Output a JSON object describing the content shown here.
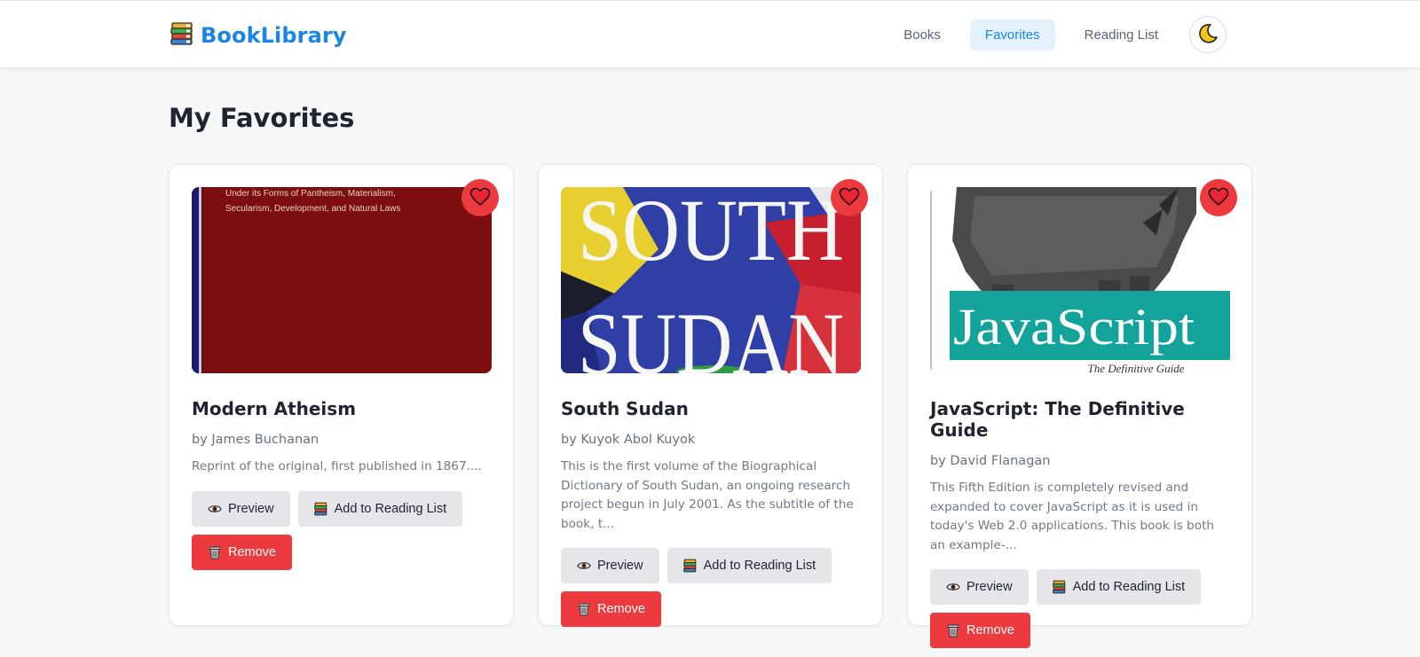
{
  "app": {
    "name": "BookLibrary",
    "logo_icon": "books-stack-icon",
    "brand_color": "#1b85e6"
  },
  "nav": {
    "items": [
      {
        "label": "Books",
        "active": false
      },
      {
        "label": "Favorites",
        "active": true
      },
      {
        "label": "Reading List",
        "active": false
      }
    ],
    "theme_toggle_icon": "crescent-moon-icon"
  },
  "page": {
    "title": "My Favorites"
  },
  "buttons": {
    "preview": "Preview",
    "add_to_reading_list": "Add to Reading List",
    "remove": "Remove"
  },
  "books": [
    {
      "title": "Modern Atheism",
      "author": "by James Buchanan",
      "description": "Reprint of the original, first published in 1867....",
      "cover_text": "Under its Forms of Pantheism, Materialism, Secularism, Development, and Natural Laws",
      "favorited": true
    },
    {
      "title": "South Sudan",
      "author": "by Kuyok Abol Kuyok",
      "description": "This is the first volume of the Biographical Dictionary of South Sudan, an ongoing research project begun in July 2001. As the subtitle of the book, t...",
      "cover_text_1": "SOUTH",
      "cover_text_2": "SUDAN",
      "favorited": true
    },
    {
      "title": "JavaScript: The Definitive Guide",
      "author": "by David Flanagan",
      "description": "This Fifth Edition is completely revised and expanded to cover JavaScript as it is used in today's Web 2.0 applications. This book is both an example-...",
      "cover_text_1": "JavaScript",
      "cover_text_2": "The Definitive Guide",
      "favorited": true
    }
  ],
  "colors": {
    "accent_red": "#ec3a3f",
    "grey_button": "#e4e6e9",
    "active_nav_bg": "#e3f1fd"
  }
}
